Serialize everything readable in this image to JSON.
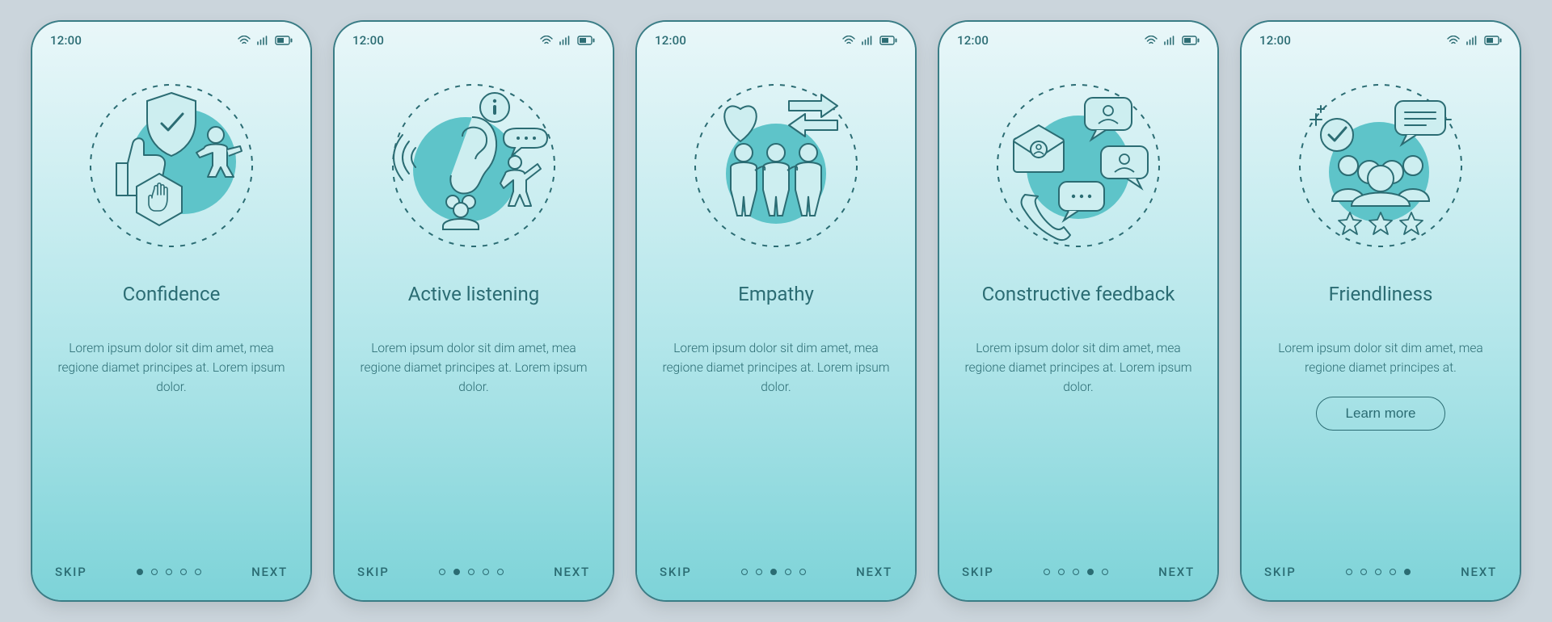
{
  "statusbar": {
    "time": "12:00"
  },
  "nav": {
    "skip": "SKIP",
    "next": "NEXT"
  },
  "learn_more": "Learn more",
  "screens": [
    {
      "title": "Confidence",
      "body": "Lorem ipsum dolor sit dim amet, mea regione diamet principes at. Lorem ipsum dolor.",
      "icon": "confidence-icon",
      "active_dot": 0,
      "has_learn_more": false
    },
    {
      "title": "Active listening",
      "body": "Lorem ipsum dolor sit dim amet, mea regione diamet principes at. Lorem ipsum dolor.",
      "icon": "active-listening-icon",
      "active_dot": 1,
      "has_learn_more": false
    },
    {
      "title": "Empathy",
      "body": "Lorem ipsum dolor sit dim amet, mea regione diamet principes at. Lorem ipsum dolor.",
      "icon": "empathy-icon",
      "active_dot": 2,
      "has_learn_more": false
    },
    {
      "title": "Constructive feedback",
      "body": "Lorem ipsum dolor sit dim amet, mea regione diamet principes at. Lorem ipsum dolor.",
      "icon": "constructive-feedback-icon",
      "active_dot": 3,
      "has_learn_more": false
    },
    {
      "title": "Friendliness",
      "body": "Lorem ipsum dolor sit dim amet, mea regione diamet principes at.",
      "icon": "friendliness-icon",
      "active_dot": 4,
      "has_learn_more": true
    }
  ],
  "colors": {
    "stroke": "#2b6c73",
    "fill": "#5ec4c9",
    "pale": "#cdeef0"
  }
}
